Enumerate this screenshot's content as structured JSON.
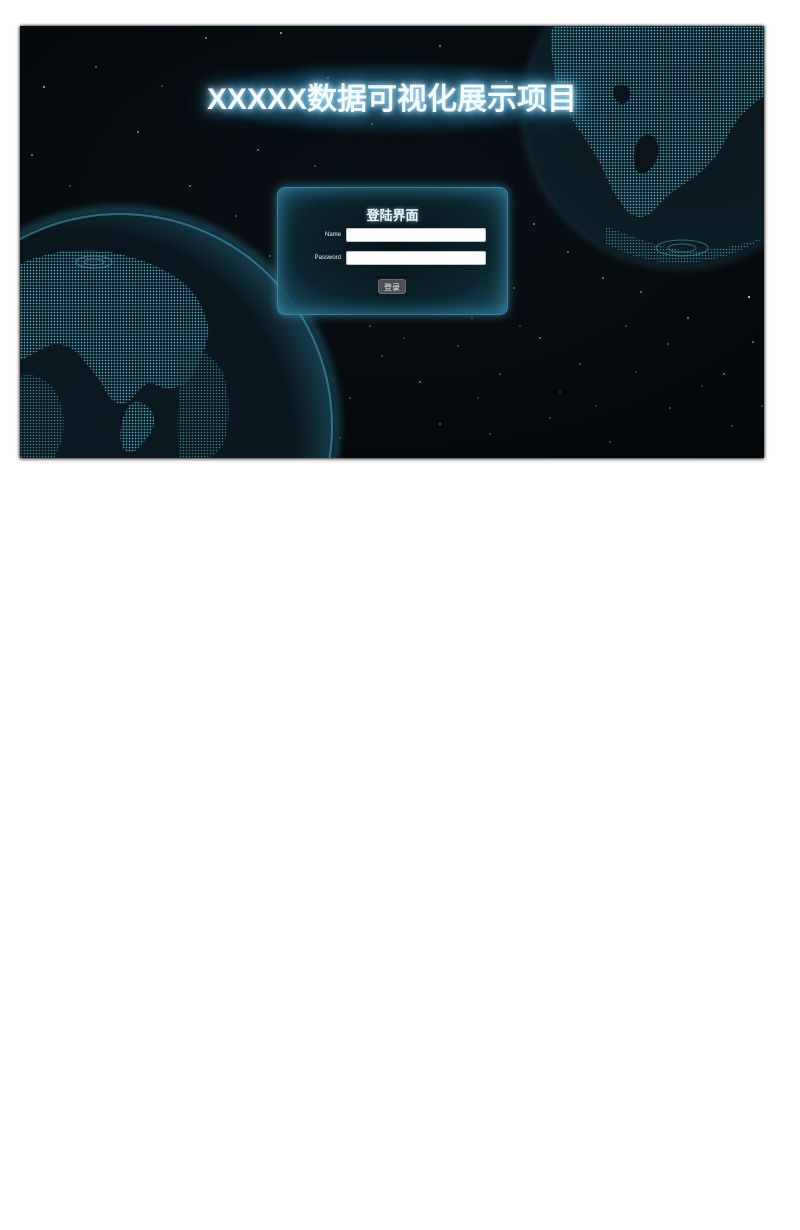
{
  "page": {
    "title": "XXXXX数据可视化展示项目"
  },
  "login": {
    "heading": "登陆界面",
    "name_label": "Name",
    "name_value": "",
    "password_label": "Password",
    "password_value": "",
    "submit_label": "登录"
  },
  "theme": {
    "background": "#060a0e",
    "glow": "#3aa6e0",
    "globe_dots": "#4fa6c0",
    "panel_border": "#5abee1"
  },
  "background": {
    "description_icons": [
      "globe-left-icon",
      "globe-right-icon",
      "stars"
    ]
  }
}
